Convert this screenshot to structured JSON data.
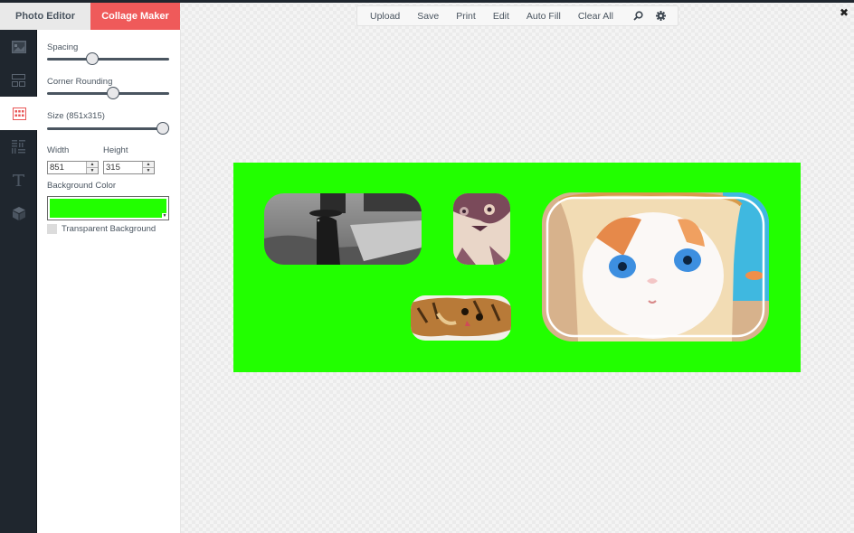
{
  "tabs": [
    {
      "label": "Photo Editor",
      "active": false
    },
    {
      "label": "Collage Maker",
      "active": true
    }
  ],
  "rail": [
    {
      "icon": "image-icon",
      "active": false
    },
    {
      "icon": "layout-icon",
      "active": false
    },
    {
      "icon": "grid-icon",
      "active": true
    },
    {
      "icon": "texture-icon",
      "active": false
    },
    {
      "icon": "text-icon",
      "active": false
    },
    {
      "icon": "cube-icon",
      "active": false
    }
  ],
  "panel": {
    "spacing": {
      "label": "Spacing",
      "value": 0.37
    },
    "corner_rounding": {
      "label": "Corner Rounding",
      "value": 0.54
    },
    "size": {
      "label": "Size (851x315)",
      "value": 0.95
    },
    "width": {
      "label": "Width",
      "value": "851"
    },
    "height": {
      "label": "Height",
      "value": "315"
    },
    "background_color": {
      "label": "Background Color",
      "value": "#22ff00"
    },
    "transparent": {
      "label": "Transparent Background",
      "checked": false
    }
  },
  "toolbar": {
    "buttons": [
      "Upload",
      "Save",
      "Print",
      "Edit",
      "Auto Fill",
      "Clear All"
    ],
    "icons": [
      "search-icon",
      "gear-icon"
    ]
  },
  "close_label": "✖",
  "colors": {
    "accent": "#ef5a5a",
    "rail_bg": "#1f262e",
    "canvas_bg": "#22ff00"
  },
  "canvas": {
    "photos": [
      {
        "subject": "black cat with top hat (grayscale)"
      },
      {
        "subject": "cat face looking up (faded)"
      },
      {
        "subject": "tabby kitten lying down"
      },
      {
        "subject": "white cat in bread slice"
      }
    ]
  }
}
